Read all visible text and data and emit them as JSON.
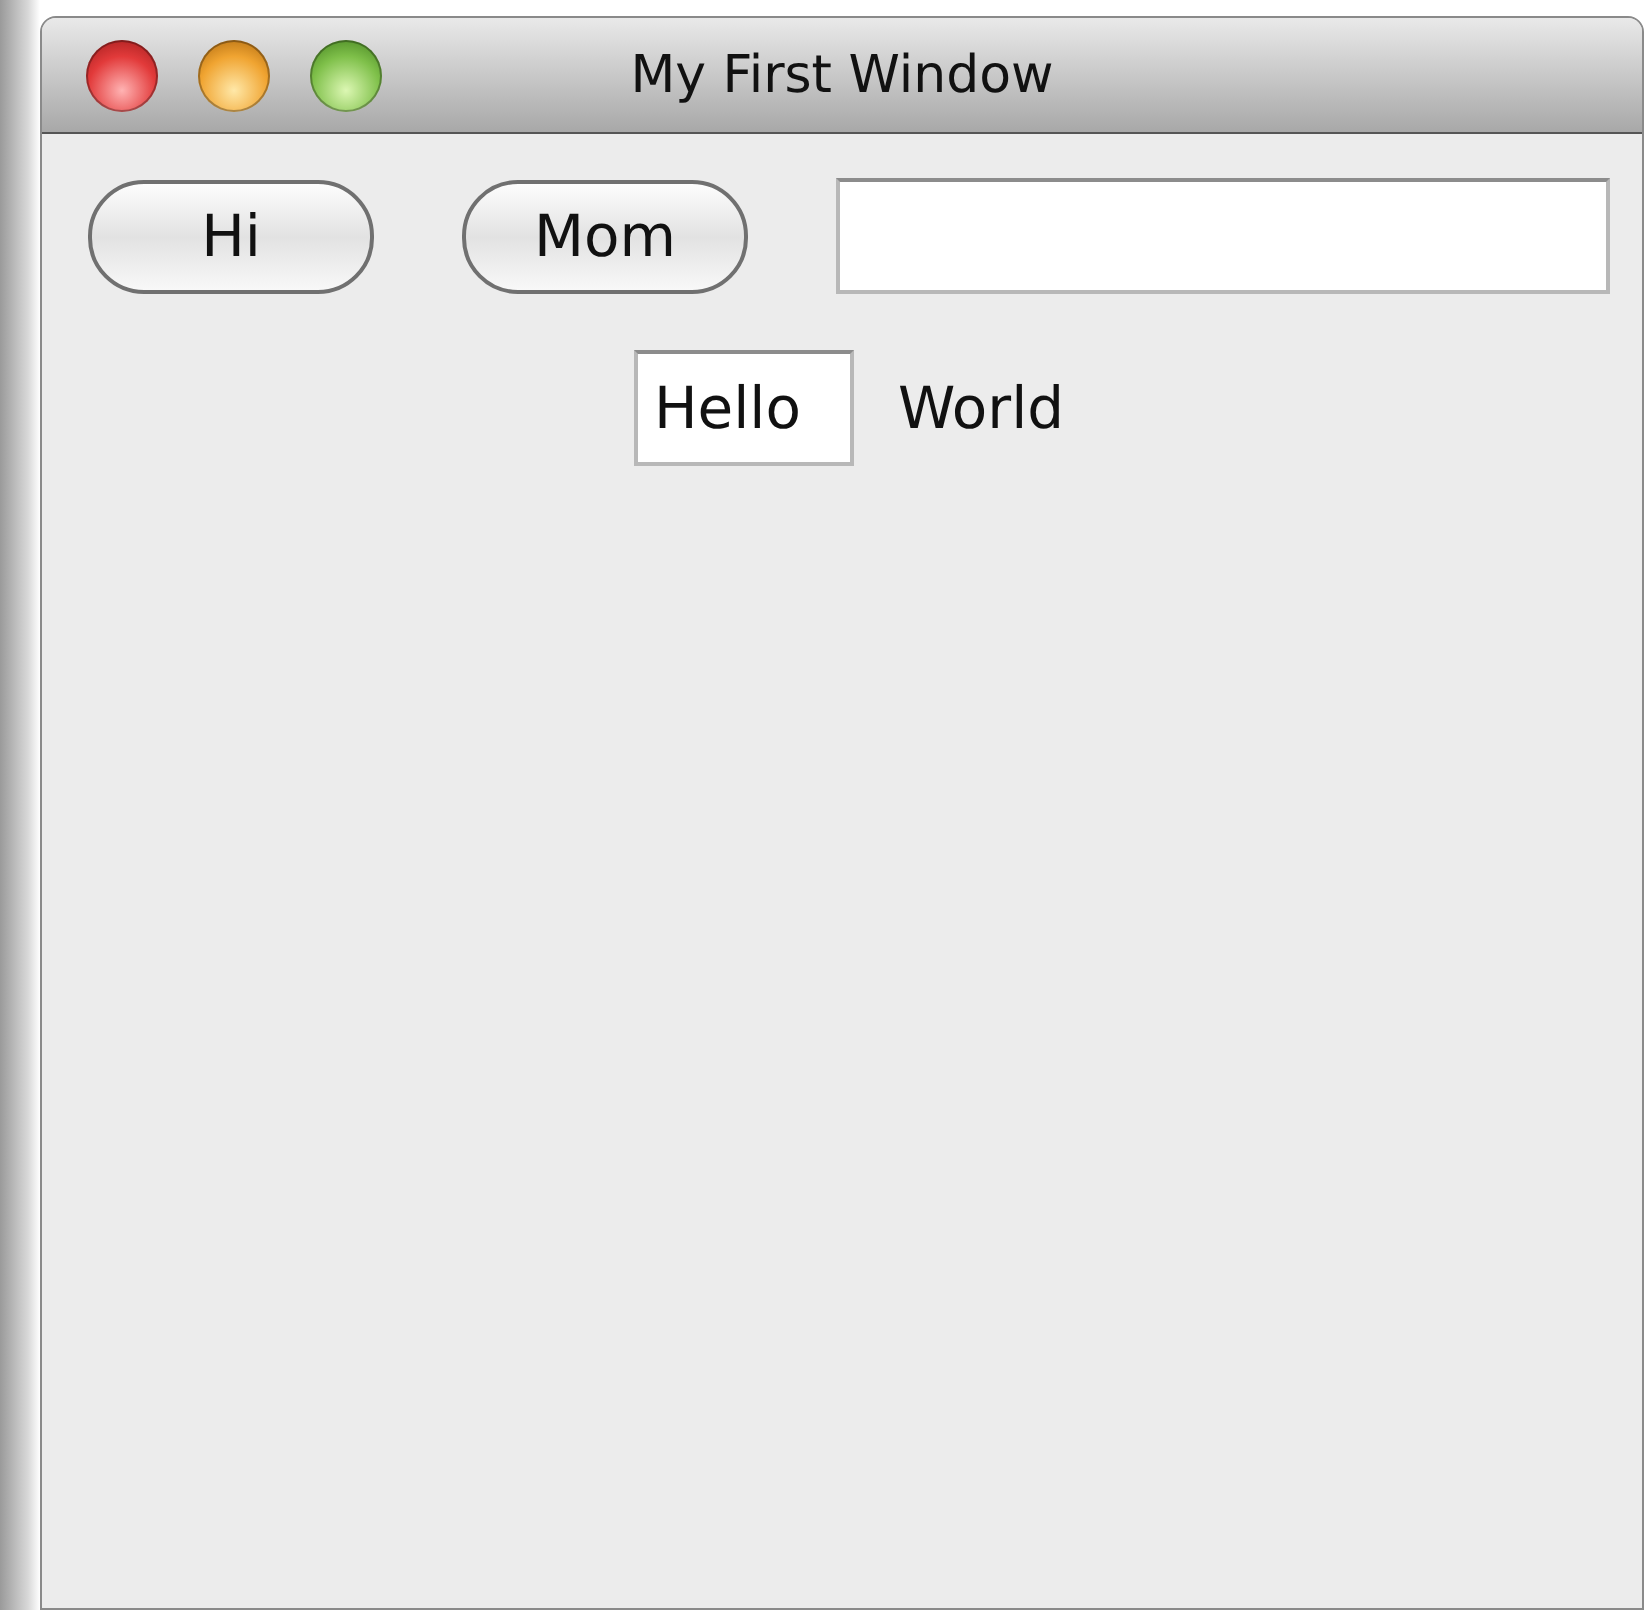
{
  "window": {
    "title": "My First Window"
  },
  "rows": [
    {
      "items": [
        {
          "kind": "button",
          "label": "Hi"
        },
        {
          "kind": "button",
          "label": "Mom"
        },
        {
          "kind": "field"
        }
      ]
    },
    {
      "items": [
        {
          "kind": "field",
          "value": "Hello"
        },
        {
          "kind": "label",
          "text": "World"
        }
      ]
    }
  ]
}
